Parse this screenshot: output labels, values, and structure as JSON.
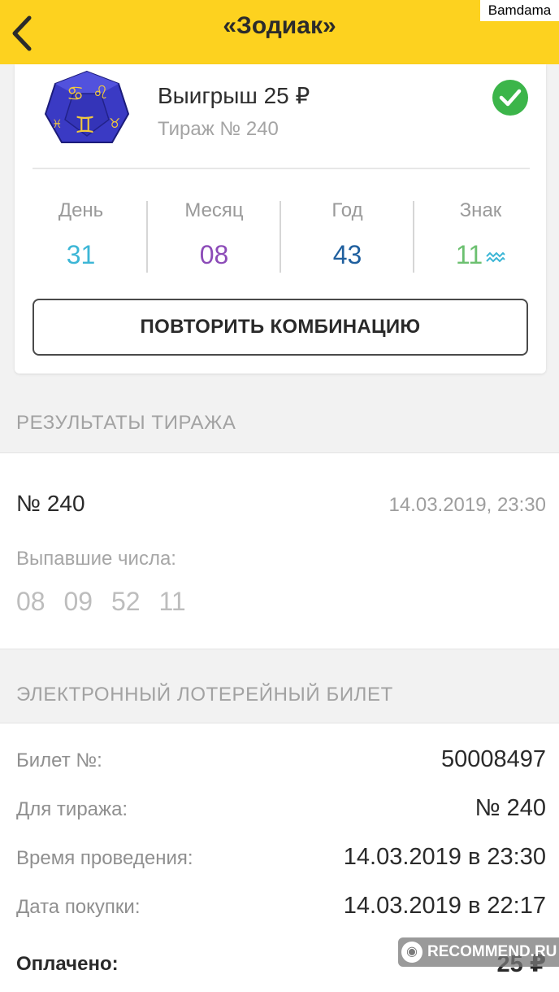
{
  "header": {
    "title": "«Зодиак»"
  },
  "watermark_top": "Bamdama",
  "ticket": {
    "win_text": "Выигрыш 25 ₽",
    "draw_text": "Тираж № 240",
    "combination": [
      {
        "label": "День",
        "value": "31",
        "color": "#3cb6d6"
      },
      {
        "label": "Месяц",
        "value": "08",
        "color": "#8c4bb8"
      },
      {
        "label": "Год",
        "value": "43",
        "color": "#1f5f9e"
      },
      {
        "label": "Знак",
        "value": "11",
        "color": "#6cc070",
        "icon": "aquarius-icon"
      }
    ],
    "repeat_button": "ПОВТОРИТЬ КОМБИНАЦИЮ"
  },
  "results": {
    "section_title": "РЕЗУЛЬТАТЫ ТИРАЖА",
    "draw_number": "№ 240",
    "datetime": "14.03.2019, 23:30",
    "numbers_label": "Выпавшие числа:",
    "numbers": [
      "08",
      "09",
      "52",
      "11"
    ]
  },
  "e_ticket": {
    "section_title": "ЭЛЕКТРОННЫЙ ЛОТЕРЕЙНЫЙ БИЛЕТ",
    "rows": [
      {
        "label": "Билет №:",
        "value": "50008497"
      },
      {
        "label": "Для тиража:",
        "value": "№ 240"
      },
      {
        "label": "Время проведения:",
        "value": "14.03.2019 в 23:30"
      },
      {
        "label": "Дата покупки:",
        "value": "14.03.2019 в 22:17"
      },
      {
        "label": "Оплачено:",
        "value": "25 ₽"
      }
    ]
  },
  "watermark_bottom": "RECOMMEND.RU",
  "colors": {
    "header_bg": "#fdd21f",
    "success": "#3cb54a"
  }
}
